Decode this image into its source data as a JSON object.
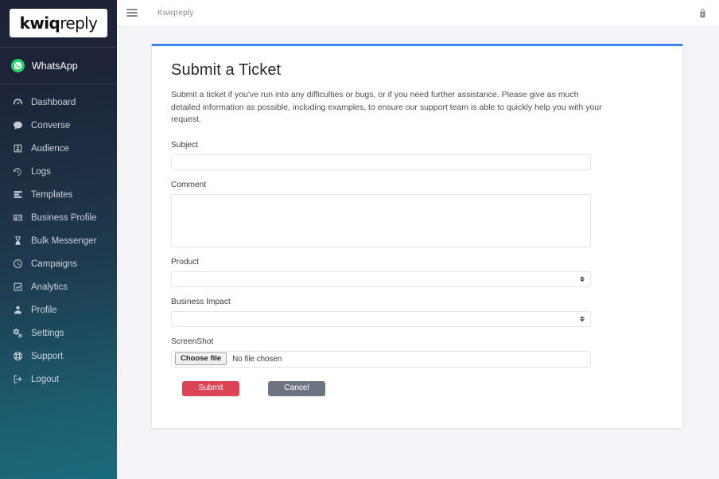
{
  "sidebar": {
    "logo": {
      "primary": "kwiq",
      "secondary": "reply"
    },
    "channel": {
      "label": "WhatsApp",
      "icon": "whatsapp-icon",
      "color": "#25d366"
    },
    "items": [
      {
        "label": "Dashboard",
        "icon": "dashboard-icon"
      },
      {
        "label": "Converse",
        "icon": "chat-bubble-icon"
      },
      {
        "label": "Audience",
        "icon": "audience-card-icon"
      },
      {
        "label": "Logs",
        "icon": "history-clock-icon"
      },
      {
        "label": "Templates",
        "icon": "templates-list-icon"
      },
      {
        "label": "Business Profile",
        "icon": "id-card-icon"
      },
      {
        "label": "Bulk Messenger",
        "icon": "hourglass-icon"
      },
      {
        "label": "Campaigns",
        "icon": "clock-icon"
      },
      {
        "label": "Analytics",
        "icon": "chart-line-icon"
      },
      {
        "label": "Profile",
        "icon": "person-icon"
      },
      {
        "label": "Settings",
        "icon": "gears-icon"
      },
      {
        "label": "Support",
        "icon": "life-ring-icon"
      },
      {
        "label": "Logout",
        "icon": "logout-icon"
      }
    ],
    "gradient_top": "#1d2239",
    "gradient_bottom": "#1a6b7c"
  },
  "topbar": {
    "menu_icon": "hamburger-icon",
    "brand": "Kwiqreply",
    "user_icon": "user-lock-icon"
  },
  "main": {
    "accent_color": "#3d85f0",
    "title": "Submit a Ticket",
    "description": "Submit a ticket if you've run into any difficulties or bugs, or if you need further assistance. Please give as much detailed information as possible, including examples, to ensure our support team is able to quickly help you with your request.",
    "form": {
      "subject": {
        "label": "Subject",
        "value": "",
        "placeholder": ""
      },
      "comment": {
        "label": "Comment",
        "value": "",
        "placeholder": ""
      },
      "product": {
        "label": "Product",
        "selected": "",
        "options": [
          ""
        ]
      },
      "business_impact": {
        "label": "Business Impact",
        "selected": "",
        "options": [
          ""
        ]
      },
      "screenshot": {
        "label": "ScreenShot",
        "button": "Choose file",
        "status": "No file chosen"
      }
    },
    "buttons": {
      "submit": {
        "label": "Submit",
        "color": "#dc4455"
      },
      "cancel": {
        "label": "Cancel",
        "color": "#6b7480"
      }
    }
  }
}
